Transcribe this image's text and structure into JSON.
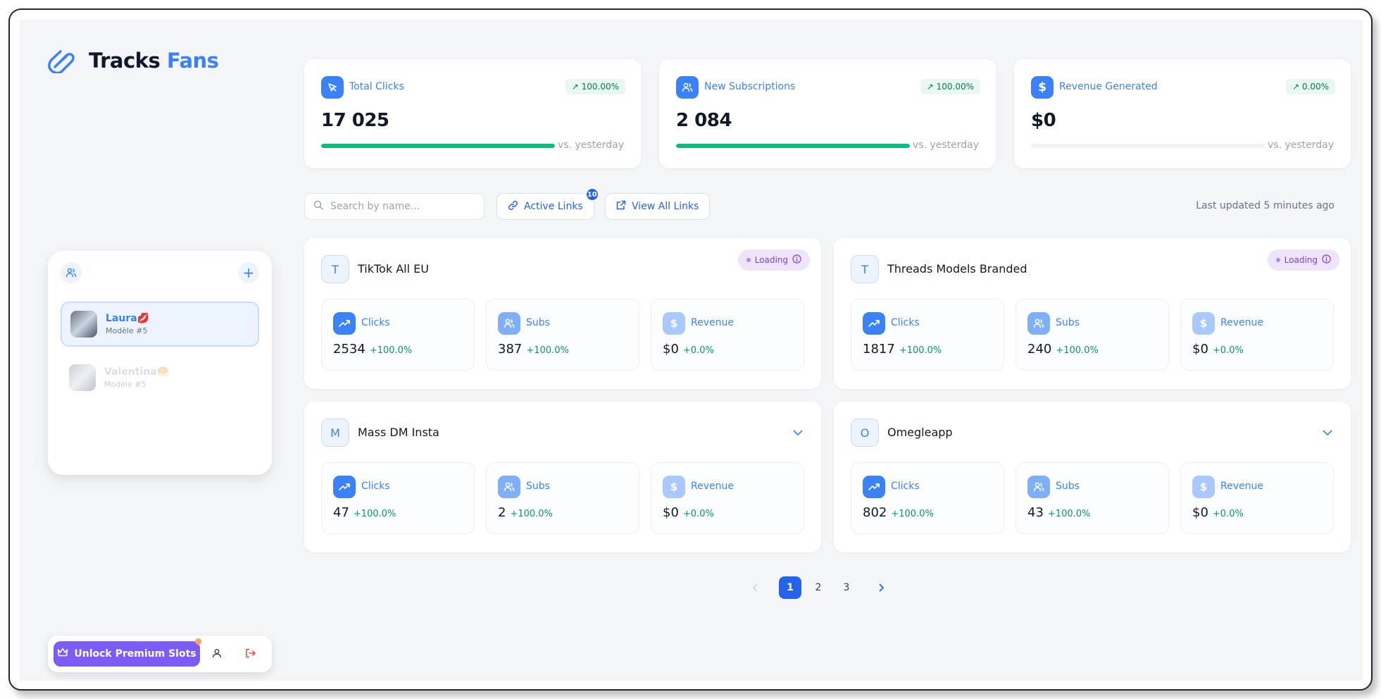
{
  "brand": {
    "name_part1": "Tracks",
    "name_part2": "Fans"
  },
  "sidebar": {
    "models": [
      {
        "name": "Laura",
        "emoji": "💋",
        "sub": "Modèle #5"
      },
      {
        "name": "Valentina",
        "emoji": "🥯",
        "sub": "Modèle #5"
      }
    ],
    "premium_label": "Unlock Premium Slots"
  },
  "stats": [
    {
      "title": "Total Clicks",
      "badge": "↗ 100.00%",
      "value": "17 025",
      "progress": 1.0,
      "vs": "vs. yesterday",
      "icon": "cursor-icon"
    },
    {
      "title": "New Subscriptions",
      "badge": "↗ 100.00%",
      "value": "2 084",
      "progress": 1.0,
      "vs": "vs. yesterday",
      "icon": "users-icon"
    },
    {
      "title": "Revenue Generated",
      "badge": "↗ 0.00%",
      "value": "$0",
      "progress": 0.0,
      "vs": "vs. yesterday",
      "icon": "dollar-icon"
    }
  ],
  "toolbar": {
    "search_placeholder": "Search by name...",
    "active_links_label": "Active Links",
    "active_links_count": "10",
    "view_all_label": "View All Links",
    "last_updated": "Last updated 5 minutes ago"
  },
  "links": [
    {
      "letter": "T",
      "name": "TikTok All EU",
      "status": "Loading",
      "metrics": [
        {
          "label": "Clicks",
          "value": "2534",
          "change": "+100.0%"
        },
        {
          "label": "Subs",
          "value": "387",
          "change": "+100.0%"
        },
        {
          "label": "Revenue",
          "value": "$0",
          "change": "+0.0%"
        }
      ]
    },
    {
      "letter": "T",
      "name": "Threads Models Branded",
      "status": "Loading",
      "metrics": [
        {
          "label": "Clicks",
          "value": "1817",
          "change": "+100.0%"
        },
        {
          "label": "Subs",
          "value": "240",
          "change": "+100.0%"
        },
        {
          "label": "Revenue",
          "value": "$0",
          "change": "+0.0%"
        }
      ]
    },
    {
      "letter": "M",
      "name": "Mass DM Insta",
      "status": "",
      "metrics": [
        {
          "label": "Clicks",
          "value": "47",
          "change": "+100.0%"
        },
        {
          "label": "Subs",
          "value": "2",
          "change": "+100.0%"
        },
        {
          "label": "Revenue",
          "value": "$0",
          "change": "+0.0%"
        }
      ]
    },
    {
      "letter": "O",
      "name": "Omegleapp",
      "status": "",
      "metrics": [
        {
          "label": "Clicks",
          "value": "802",
          "change": "+100.0%"
        },
        {
          "label": "Subs",
          "value": "43",
          "change": "+100.0%"
        },
        {
          "label": "Revenue",
          "value": "$0",
          "change": "+0.0%"
        }
      ]
    }
  ],
  "pagination": {
    "pages": [
      "1",
      "2",
      "3"
    ],
    "current": "1"
  },
  "colors": {
    "accent": "#3b82f6",
    "premium": "#7c5cf5",
    "success": "#10b981"
  }
}
